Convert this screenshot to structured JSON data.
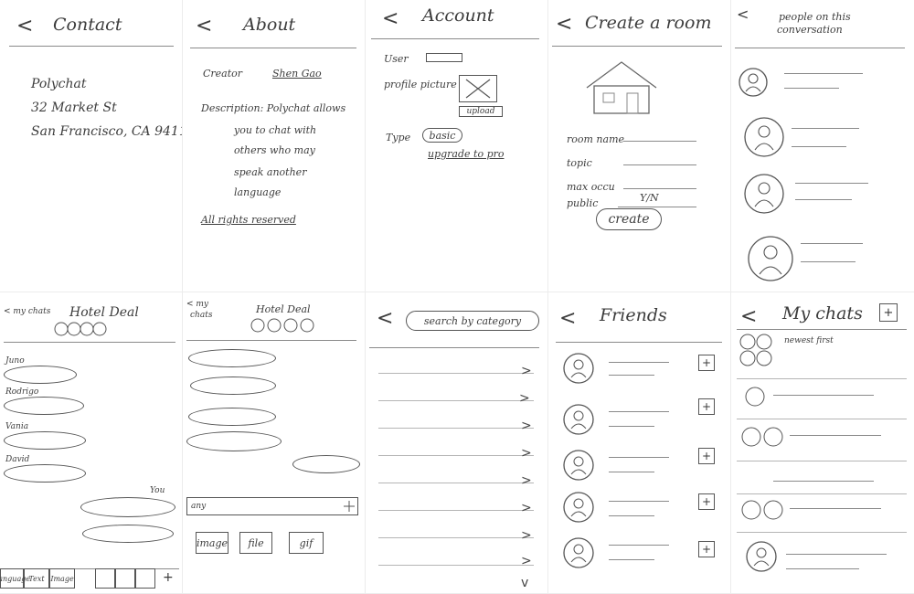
{
  "contact": {
    "title": "Contact",
    "company": "Polychat",
    "street": "32 Market St",
    "city": "San Francisco, CA 9411"
  },
  "about": {
    "title": "About",
    "creator_label": "Creator",
    "creator_name": "Shen Gao",
    "description": [
      "Description: Polychat allows",
      "you to chat with",
      "others who may",
      "speak another",
      "language"
    ],
    "rights": "All rights reserved"
  },
  "account": {
    "title": "Account",
    "user_label": "User",
    "profile_picture_label": "profile picture",
    "upload_label": "upload",
    "type_label": "Type",
    "type_value": "basic",
    "upgrade_label": "upgrade to pro"
  },
  "create_room": {
    "title": "Create a room",
    "fields": [
      "room name",
      "topic",
      "max occu",
      "public"
    ],
    "public_value": "Y/N",
    "create_label": "create"
  },
  "people": {
    "title_line1": "people on this",
    "title_line2": "conversation"
  },
  "chat_view": {
    "back_label": "< my chats",
    "title": "Hotel Deal",
    "senders": [
      "Juno",
      "Rodrigo",
      "Vania",
      "David"
    ],
    "me_label": "You",
    "bottom_tabs": [
      "Language",
      "Text",
      "Image"
    ],
    "plus_label": "+"
  },
  "chat_compose": {
    "back_label_line1": "< my",
    "back_label_line2": "chats",
    "title": "Hotel Deal",
    "input_placeholder": "any",
    "attach_buttons": [
      "image",
      "file",
      "gif"
    ]
  },
  "search": {
    "placeholder": "search by category"
  },
  "friends": {
    "title": "Friends"
  },
  "my_chats": {
    "title": "My chats",
    "add_label": "+",
    "newest_label": "newest first"
  }
}
